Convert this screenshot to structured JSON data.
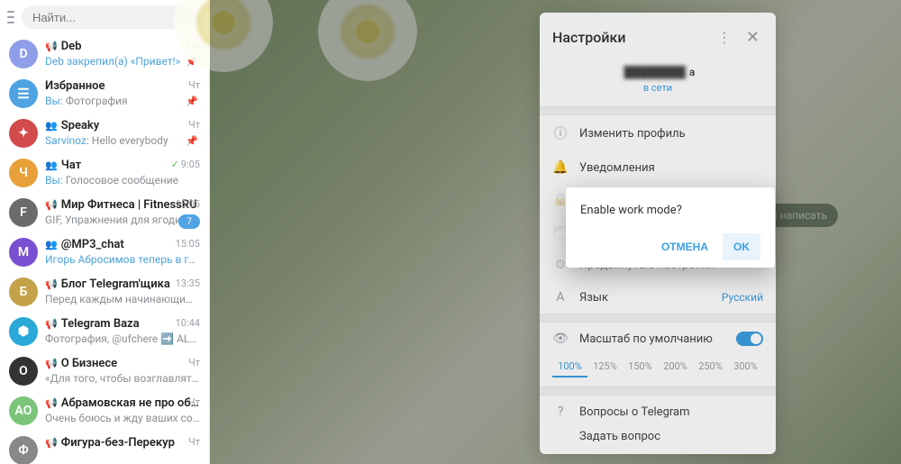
{
  "search": {
    "placeholder": "Найти..."
  },
  "chats": [
    {
      "icon": "📢",
      "name": "Deb",
      "msg_prefix": "",
      "msg": "Deb закрепил(а) «Привет!»",
      "msg_color": "#4ea3d9",
      "time": "Пн",
      "pin": true,
      "avatar_bg": "#8e9ee8",
      "avatar_txt": "D"
    },
    {
      "icon": "",
      "name": "Избранное",
      "msg_prefix": "Вы: ",
      "msg": "Фотография",
      "time": "Чт",
      "pin": true,
      "avatar_bg": "#4fa3e2",
      "avatar_txt": "☰",
      "saved": true
    },
    {
      "icon": "👥",
      "name": "Speaky",
      "msg_prefix": "Sarvinoz: ",
      "msg": "Hello everybody",
      "prefix_color": "#4ea3d9",
      "time": "Чт",
      "pin": true,
      "avatar_bg": "#d24a4a",
      "avatar_txt": "✦"
    },
    {
      "icon": "👥",
      "name": "Чат",
      "msg_prefix": "Вы: ",
      "msg": "Голосовое сообщение",
      "time": "9:05",
      "check": true,
      "avatar_bg": "#e8a13a",
      "avatar_txt": "Ч"
    },
    {
      "icon": "📢",
      "name": "Мир Фитнеса | FitnessRU",
      "msg_prefix": "",
      "msg": "GIF, Упражнения для ягодиц, по ...",
      "time": "15:05",
      "badge": "7",
      "avatar_bg": "#6b6b6b",
      "avatar_txt": "F"
    },
    {
      "icon": "👥",
      "name": "@MP3_chat",
      "msg_prefix": "",
      "msg": "Игорь Абросимов теперь в группе",
      "msg_color": "#4ea3d9",
      "time": "15:05",
      "avatar_bg": "#7a4fd1",
      "avatar_txt": "M"
    },
    {
      "icon": "📢",
      "name": "Блог Telegram'щика",
      "msg_prefix": "",
      "msg": "Перед каждым начинающим пред...",
      "time": "13:35",
      "avatar_bg": "#c4a24a",
      "avatar_txt": "Б"
    },
    {
      "icon": "📢",
      "name": "Telegram Baza",
      "msg_prefix": "",
      "msg": "Фотография, @ufchere ➡️ ALL MMA ...",
      "time": "10:44",
      "avatar_bg": "#2aa8d8",
      "avatar_txt": "⬢"
    },
    {
      "icon": "📢",
      "name": "О Бизнесе",
      "msg_prefix": "",
      "msg": "«Для того, чтобы возглавлять компа...",
      "time": "Чт",
      "avatar_bg": "#333",
      "avatar_txt": "О"
    },
    {
      "icon": "📢",
      "name": "Абрамовская не про обрабо...",
      "msg_prefix": "",
      "msg": "Очень боюсь и жду ваших совет...",
      "time": "Чт",
      "badge": "",
      "avatar_bg": "#7ac57a",
      "avatar_txt": "АО"
    },
    {
      "icon": "📢",
      "name": "Фигура-без-Перекур",
      "msg_prefix": "",
      "msg": "",
      "time": "Чт",
      "avatar_bg": "#888",
      "avatar_txt": "Ф"
    }
  ],
  "hint": "бы написать",
  "settings": {
    "title": "Настройки",
    "profile_name_suffix": "а",
    "profile_status": "в сети",
    "items": {
      "edit": "Изменить профиль",
      "notif": "Уведомления",
      "adv": "Продвинутые настройки",
      "lang_label": "Язык",
      "lang_value": "Русский",
      "scale_label": "Масштаб по умолчанию",
      "faq": "Вопросы о Telegram",
      "ask": "Задать вопрос"
    },
    "scales": [
      "100%",
      "125%",
      "150%",
      "200%",
      "250%",
      "300%"
    ]
  },
  "dialog": {
    "message": "Enable work mode?",
    "cancel": "ОТМЕНА",
    "ok": "OK"
  }
}
